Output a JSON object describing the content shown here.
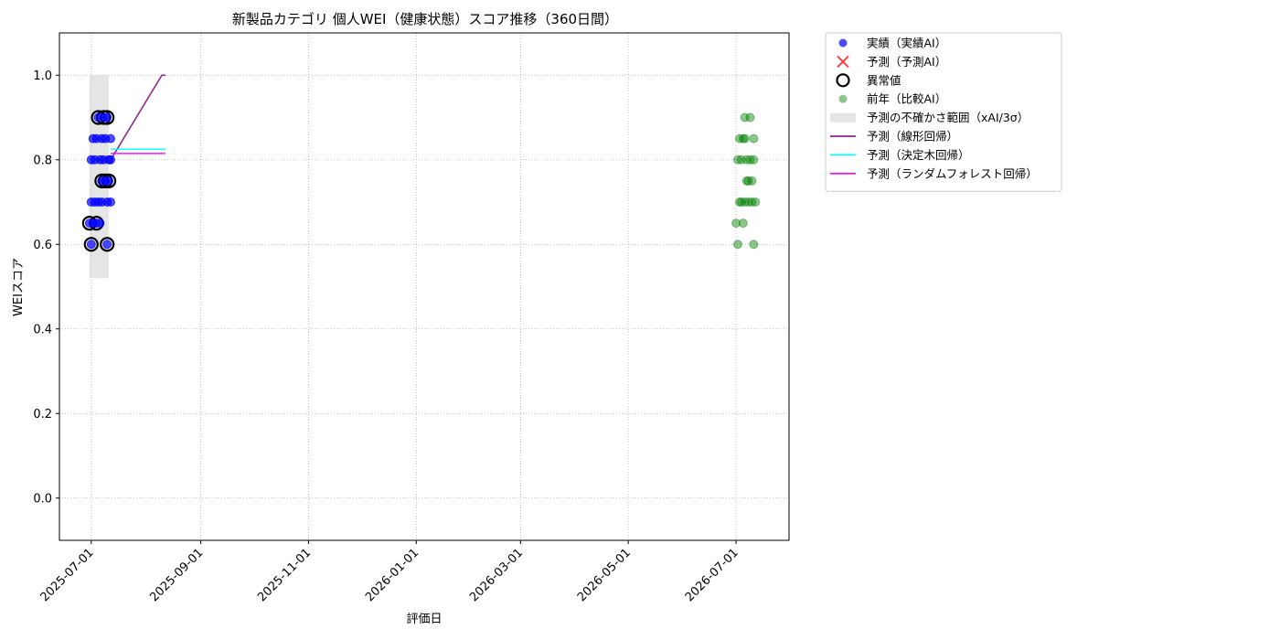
{
  "chart_data": {
    "type": "scatter",
    "title": "新製品カテゴリ 個人WEI（健康状態）スコア推移（360日間）",
    "xlabel": "評価日",
    "ylabel": "WEIスコア",
    "xlim": [
      "2025-06-13",
      "2026-07-31"
    ],
    "ylim": [
      -0.1,
      1.1
    ],
    "x_ticks": [
      "2025-07-01",
      "2025-09-01",
      "2025-11-01",
      "2026-01-01",
      "2026-03-01",
      "2026-05-01",
      "2026-07-01"
    ],
    "y_ticks": [
      0.0,
      0.2,
      0.4,
      0.6,
      0.8,
      1.0
    ],
    "y_tick_labels": [
      "0.0",
      "0.2",
      "0.4",
      "0.6",
      "0.8",
      "1.0"
    ],
    "grid": true,
    "legend_position": "outside-top-right",
    "legend": [
      {
        "label": "実績（実績AI）",
        "marker": "dot",
        "color": "#0000ff"
      },
      {
        "label": "予測（予測AI）",
        "marker": "x",
        "color": "#ff0000"
      },
      {
        "label": "異常値",
        "marker": "ring",
        "color": "#000000"
      },
      {
        "label": "前年（比較AI）",
        "marker": "dot",
        "color": "#008000"
      },
      {
        "label": "予測の不確かさ範囲（xAI/3σ）",
        "marker": "band",
        "color": "#d3d3d3"
      },
      {
        "label": "予測（線形回帰）",
        "marker": "line",
        "color": "#800080"
      },
      {
        "label": "予測（決定木回帰）",
        "marker": "line",
        "color": "#00ffff"
      },
      {
        "label": "予測（ランダムフォレスト回帰）",
        "marker": "line",
        "color": "#ff00ff"
      }
    ],
    "series": [
      {
        "name": "実績（実績AI）",
        "kind": "scatter",
        "color": "#0000ff",
        "points": [
          [
            "2025-06-30",
            0.65
          ],
          [
            "2025-07-01",
            0.7
          ],
          [
            "2025-07-01",
            0.8
          ],
          [
            "2025-07-01",
            0.6
          ],
          [
            "2025-07-02",
            0.85
          ],
          [
            "2025-07-02",
            0.65
          ],
          [
            "2025-07-03",
            0.7
          ],
          [
            "2025-07-03",
            0.8
          ],
          [
            "2025-07-04",
            0.65
          ],
          [
            "2025-07-04",
            0.85
          ],
          [
            "2025-07-05",
            0.9
          ],
          [
            "2025-07-05",
            0.7
          ],
          [
            "2025-07-06",
            0.65
          ],
          [
            "2025-07-06",
            0.8
          ],
          [
            "2025-07-07",
            0.75
          ],
          [
            "2025-07-07",
            0.85
          ],
          [
            "2025-07-07",
            0.7
          ],
          [
            "2025-07-08",
            0.9
          ],
          [
            "2025-07-08",
            0.8
          ],
          [
            "2025-07-09",
            0.75
          ],
          [
            "2025-07-09",
            0.85
          ],
          [
            "2025-07-10",
            0.7
          ],
          [
            "2025-07-10",
            0.6
          ],
          [
            "2025-07-10",
            0.9
          ],
          [
            "2025-07-11",
            0.75
          ],
          [
            "2025-07-11",
            0.8
          ],
          [
            "2025-07-12",
            0.7
          ],
          [
            "2025-07-12",
            0.85
          ],
          [
            "2025-07-12",
            0.8
          ]
        ]
      },
      {
        "name": "異常値",
        "kind": "ring",
        "color": "#000000",
        "points": [
          [
            "2025-06-30",
            0.65
          ],
          [
            "2025-07-01",
            0.6
          ],
          [
            "2025-07-04",
            0.65
          ],
          [
            "2025-07-05",
            0.9
          ],
          [
            "2025-07-07",
            0.75
          ],
          [
            "2025-07-08",
            0.9
          ],
          [
            "2025-07-09",
            0.75
          ],
          [
            "2025-07-10",
            0.6
          ],
          [
            "2025-07-10",
            0.9
          ],
          [
            "2025-07-11",
            0.75
          ]
        ]
      },
      {
        "name": "前年（比較AI）",
        "kind": "scatter",
        "color": "#008000",
        "points": [
          [
            "2026-07-01",
            0.65
          ],
          [
            "2026-07-02",
            0.6
          ],
          [
            "2026-07-02",
            0.8
          ],
          [
            "2026-07-03",
            0.7
          ],
          [
            "2026-07-03",
            0.85
          ],
          [
            "2026-07-04",
            0.8
          ],
          [
            "2026-07-04",
            0.7
          ],
          [
            "2026-07-05",
            0.85
          ],
          [
            "2026-07-05",
            0.65
          ],
          [
            "2026-07-06",
            0.7
          ],
          [
            "2026-07-06",
            0.9
          ],
          [
            "2026-07-06",
            0.85
          ],
          [
            "2026-07-07",
            0.75
          ],
          [
            "2026-07-07",
            0.8
          ],
          [
            "2026-07-08",
            0.7
          ],
          [
            "2026-07-08",
            0.75
          ],
          [
            "2026-07-09",
            0.8
          ],
          [
            "2026-07-09",
            0.9
          ],
          [
            "2026-07-10",
            0.7
          ],
          [
            "2026-07-10",
            0.75
          ],
          [
            "2026-07-11",
            0.6
          ],
          [
            "2026-07-11",
            0.8
          ],
          [
            "2026-07-11",
            0.85
          ],
          [
            "2026-07-12",
            0.7
          ]
        ]
      },
      {
        "name": "予測の不確かさ範囲（xAI/3σ）",
        "kind": "band",
        "color": "#d3d3d3",
        "x_range": [
          "2025-06-30",
          "2025-07-11"
        ],
        "y_range": [
          0.52,
          1.0
        ]
      },
      {
        "name": "予測（線形回帰）",
        "kind": "line",
        "color": "#800080",
        "points": [
          [
            "2025-07-12",
            0.8
          ],
          [
            "2025-08-10",
            1.0
          ],
          [
            "2025-08-12",
            1.0
          ]
        ]
      },
      {
        "name": "予測（決定木回帰）",
        "kind": "line",
        "color": "#00ffff",
        "points": [
          [
            "2025-07-12",
            0.825
          ],
          [
            "2025-08-12",
            0.825
          ]
        ]
      },
      {
        "name": "予測（ランダムフォレスト回帰）",
        "kind": "line",
        "color": "#ff00ff",
        "points": [
          [
            "2025-07-12",
            0.815
          ],
          [
            "2025-08-12",
            0.815
          ]
        ]
      }
    ]
  }
}
